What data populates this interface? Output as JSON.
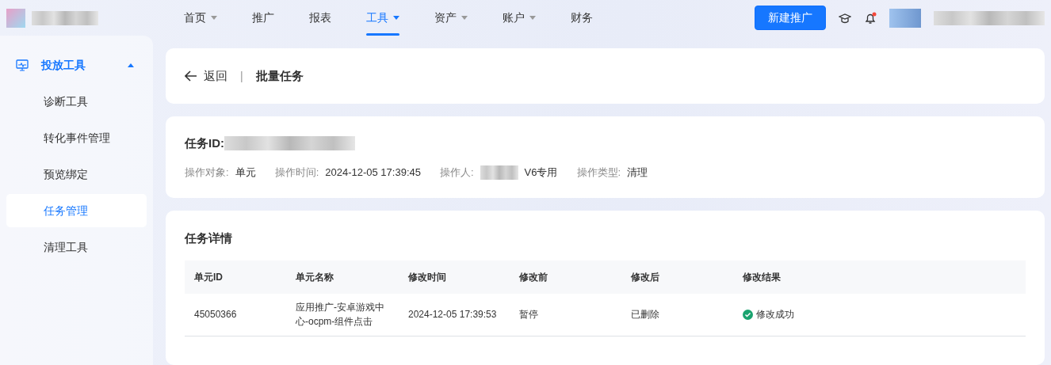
{
  "top_nav": [
    {
      "label": "首页",
      "dropdown": true,
      "selected": false
    },
    {
      "label": "推广",
      "dropdown": false,
      "selected": false
    },
    {
      "label": "报表",
      "dropdown": false,
      "selected": false
    },
    {
      "label": "工具",
      "dropdown": true,
      "selected": true
    },
    {
      "label": "资产",
      "dropdown": true,
      "selected": false
    },
    {
      "label": "账户",
      "dropdown": true,
      "selected": false
    },
    {
      "label": "财务",
      "dropdown": false,
      "selected": false
    }
  ],
  "new_button": "新建推广",
  "notification_dot": true,
  "sidebar": {
    "group": {
      "label": "投放工具",
      "expanded": true
    },
    "items": [
      {
        "label": "诊断工具",
        "selected": false
      },
      {
        "label": "转化事件管理",
        "selected": false
      },
      {
        "label": "预览绑定",
        "selected": false
      },
      {
        "label": "任务管理",
        "selected": true
      },
      {
        "label": "清理工具",
        "selected": false
      }
    ]
  },
  "header": {
    "back": "返回",
    "separator": "|",
    "title": "批量任务"
  },
  "task": {
    "id_label": "任务ID:",
    "meta": [
      {
        "label": "操作对象:",
        "value": "单元",
        "redacted": false
      },
      {
        "label": "操作时间:",
        "value": "2024-12-05 17:39:45",
        "redacted": false
      },
      {
        "label": "操作人:",
        "value": "V6专用",
        "redacted": true
      },
      {
        "label": "操作类型:",
        "value": "清理",
        "redacted": false
      }
    ]
  },
  "details": {
    "title": "任务详情",
    "table": {
      "columns": [
        "单元ID",
        "单元名称",
        "修改时间",
        "修改前",
        "修改后",
        "修改结果"
      ],
      "rows": [
        {
          "cells": [
            "45050366",
            "应用推广-安卓游戏中心-ocpm-组件点击",
            "2024-12-05 17:39:53",
            "暂停",
            "已删除",
            "修改成功"
          ],
          "success": true
        }
      ]
    }
  }
}
